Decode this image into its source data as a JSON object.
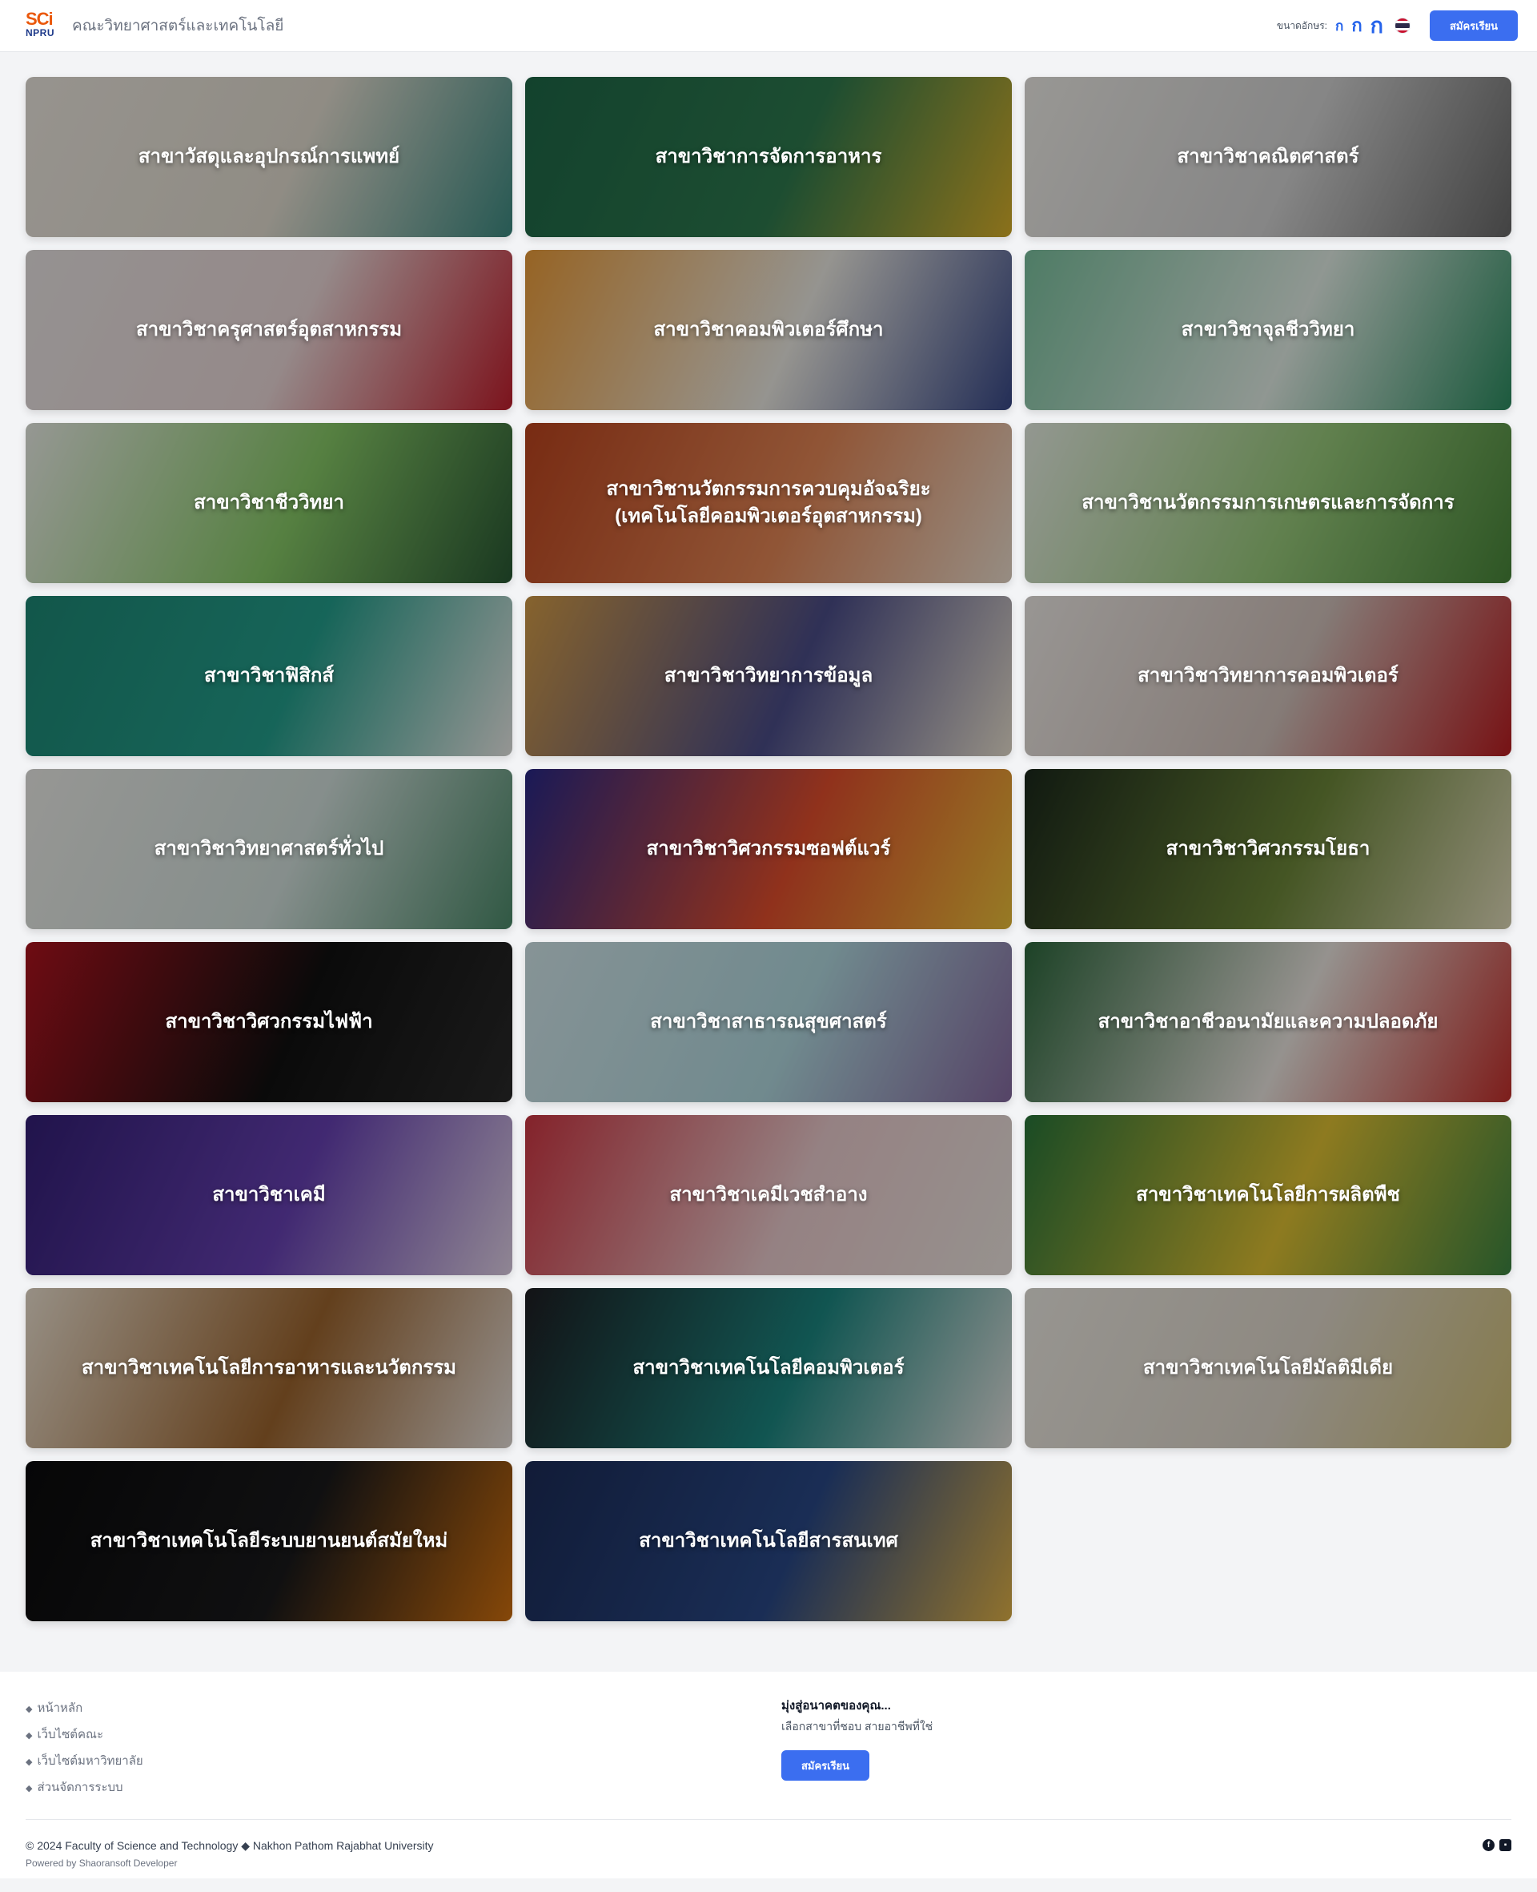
{
  "header": {
    "logo_top": "SCi",
    "logo_bottom": "NPRU",
    "title": "คณะวิทยาศาสตร์และเทคโนโลยี",
    "font_size_label": "ขนาดอักษร:",
    "font_small": "ก",
    "font_medium": "ก",
    "font_large": "ก",
    "apply_label": "สมัครเรียน"
  },
  "programs": [
    {
      "name": "สาขาวัสดุและอุปกรณ์การแพทย์",
      "colors": [
        "#f3eee6",
        "#e9e3d6",
        "#3f8f86"
      ]
    },
    {
      "name": "สาขาวิชาการจัดการอาหาร",
      "colors": [
        "#1f6b4a",
        "#2f7d50",
        "#e0b62c"
      ]
    },
    {
      "name": "สาขาวิชาคณิตศาสตร์",
      "colors": [
        "#f6f4ef",
        "#d8d8d8",
        "#6c6c6c"
      ]
    },
    {
      "name": "สาขาวิชาครุศาสตร์อุตสาหกรรม",
      "colors": [
        "#f1eceb",
        "#f1dede",
        "#c8202f"
      ]
    },
    {
      "name": "สาขาวิชาคอมพิวเตอร์ศึกษา",
      "colors": [
        "#f3a13b",
        "#f1efe8",
        "#3a4b8c"
      ]
    },
    {
      "name": "สาขาวิชาจุลชีววิทยา",
      "colors": [
        "#7fc8a4",
        "#e8f4ec",
        "#2e9164"
      ]
    },
    {
      "name": "สาขาวิชาชีววิทยา",
      "colors": [
        "#f2f5ee",
        "#8bcf6a",
        "#2a5b35"
      ]
    },
    {
      "name": "สาขาวิชานวัตกรรมการควบคุมอัจฉริยะ (เทคโนโลยีคอมพิวเตอร์อุตสาหกรรม)",
      "colors": [
        "#c2461f",
        "#e98a58",
        "#f2e3d3"
      ]
    },
    {
      "name": "สาขาวิชานวัตกรรมการเกษตรและการจัดการ",
      "colors": [
        "#eef5ea",
        "#9ccf7e",
        "#4a8a3b"
      ]
    },
    {
      "name": "สาขาวิชาฟิสิกส์",
      "colors": [
        "#1e8c78",
        "#25a390",
        "#f1f1ee"
      ]
    },
    {
      "name": "สาขาวิชาวิทยาการข้อมูล",
      "colors": [
        "#d9a04a",
        "#4d4f8c",
        "#f0e7d6"
      ]
    },
    {
      "name": "สาขาวิชาวิทยาการคอมพิวเตอร์",
      "colors": [
        "#f6f2ee",
        "#d7c7c0",
        "#c01e22"
      ]
    },
    {
      "name": "สาขาวิชาวิทยาศาสตร์ทั่วไป",
      "colors": [
        "#f3f3ef",
        "#d8e6e2",
        "#4f8f6e"
      ]
    },
    {
      "name": "สาขาวิชาวิศวกรรมซอฟต์แวร์",
      "colors": [
        "#2a2a8c",
        "#e8502e",
        "#f4c63c"
      ]
    },
    {
      "name": "สาขาวิชาวิศวกรรมโยธา",
      "colors": [
        "#1c2a1c",
        "#6f8a3a",
        "#e8e2c0"
      ]
    },
    {
      "name": "สาขาวิชาวิศวกรรมไฟฟ้า",
      "colors": [
        "#b3141f",
        "#111111",
        "#2b2b2b"
      ]
    },
    {
      "name": "สาขาวิชาสาธารณสุขศาสตร์",
      "colors": [
        "#d9eef2",
        "#b6dfe6",
        "#8a6ea6"
      ]
    },
    {
      "name": "สาขาวิชาอาชีวอนามัยและความปลอดภัย",
      "colors": [
        "#2f6b3f",
        "#f1ece6",
        "#c9302c"
      ]
    },
    {
      "name": "สาขาวิชาเคมี",
      "colors": [
        "#35207a",
        "#6a43b8",
        "#e8d8ee"
      ]
    },
    {
      "name": "สาขาวิชาเคมีเวชสำอาง",
      "colors": [
        "#d53845",
        "#f1d1d3",
        "#f4ece6"
      ]
    },
    {
      "name": "สาขาวิชาเทคโนโลยีการผลิตพืช",
      "colors": [
        "#2a7a3c",
        "#e5c634",
        "#3f8a44"
      ]
    },
    {
      "name": "สาขาวิชาเทคโนโลยีการอาหารและนวัตกรรม",
      "colors": [
        "#f3e7d6",
        "#a0672f",
        "#efe7e1"
      ]
    },
    {
      "name": "สาขาวิชาเทคโนโลยีคอมพิวเตอร์",
      "colors": [
        "#1f1f24",
        "#1c8a84",
        "#ecebe8"
      ]
    },
    {
      "name": "สาขาวิชาเทคโนโลยีมัลติมีเดีย",
      "colors": [
        "#f4f1ea",
        "#e5ddd0",
        "#d8c67a"
      ]
    },
    {
      "name": "สาขาวิชาเทคโนโลยีระบบยานยนต์สมัยใหม่",
      "colors": [
        "#0b0b0c",
        "#1a1a1c",
        "#d8740f"
      ]
    },
    {
      "name": "สาขาวิชาเทคโนโลยีสารสนเทศ",
      "colors": [
        "#1c2d5a",
        "#2a4a8a",
        "#e8b84a"
      ]
    }
  ],
  "footer": {
    "links": [
      "หน้าหลัก",
      "เว็บไซต์คณะ",
      "เว็บไซต์มหาวิทยาลัย",
      "ส่วนจัดการระบบ"
    ],
    "cta_heading": "มุ่งสู่อนาคตของคุณ...",
    "cta_text": "เลือกสาขาที่ชอบ สายอาชีพที่ใช่",
    "cta_button": "สมัครเรียน",
    "copyright": "© 2024 Faculty of Science and Technology ◆ Nakhon Pathom Rajabhat University",
    "powered_by": "Powered by Shaoransoft Developer",
    "social_icons": [
      "facebook-icon",
      "chat-icon"
    ]
  }
}
